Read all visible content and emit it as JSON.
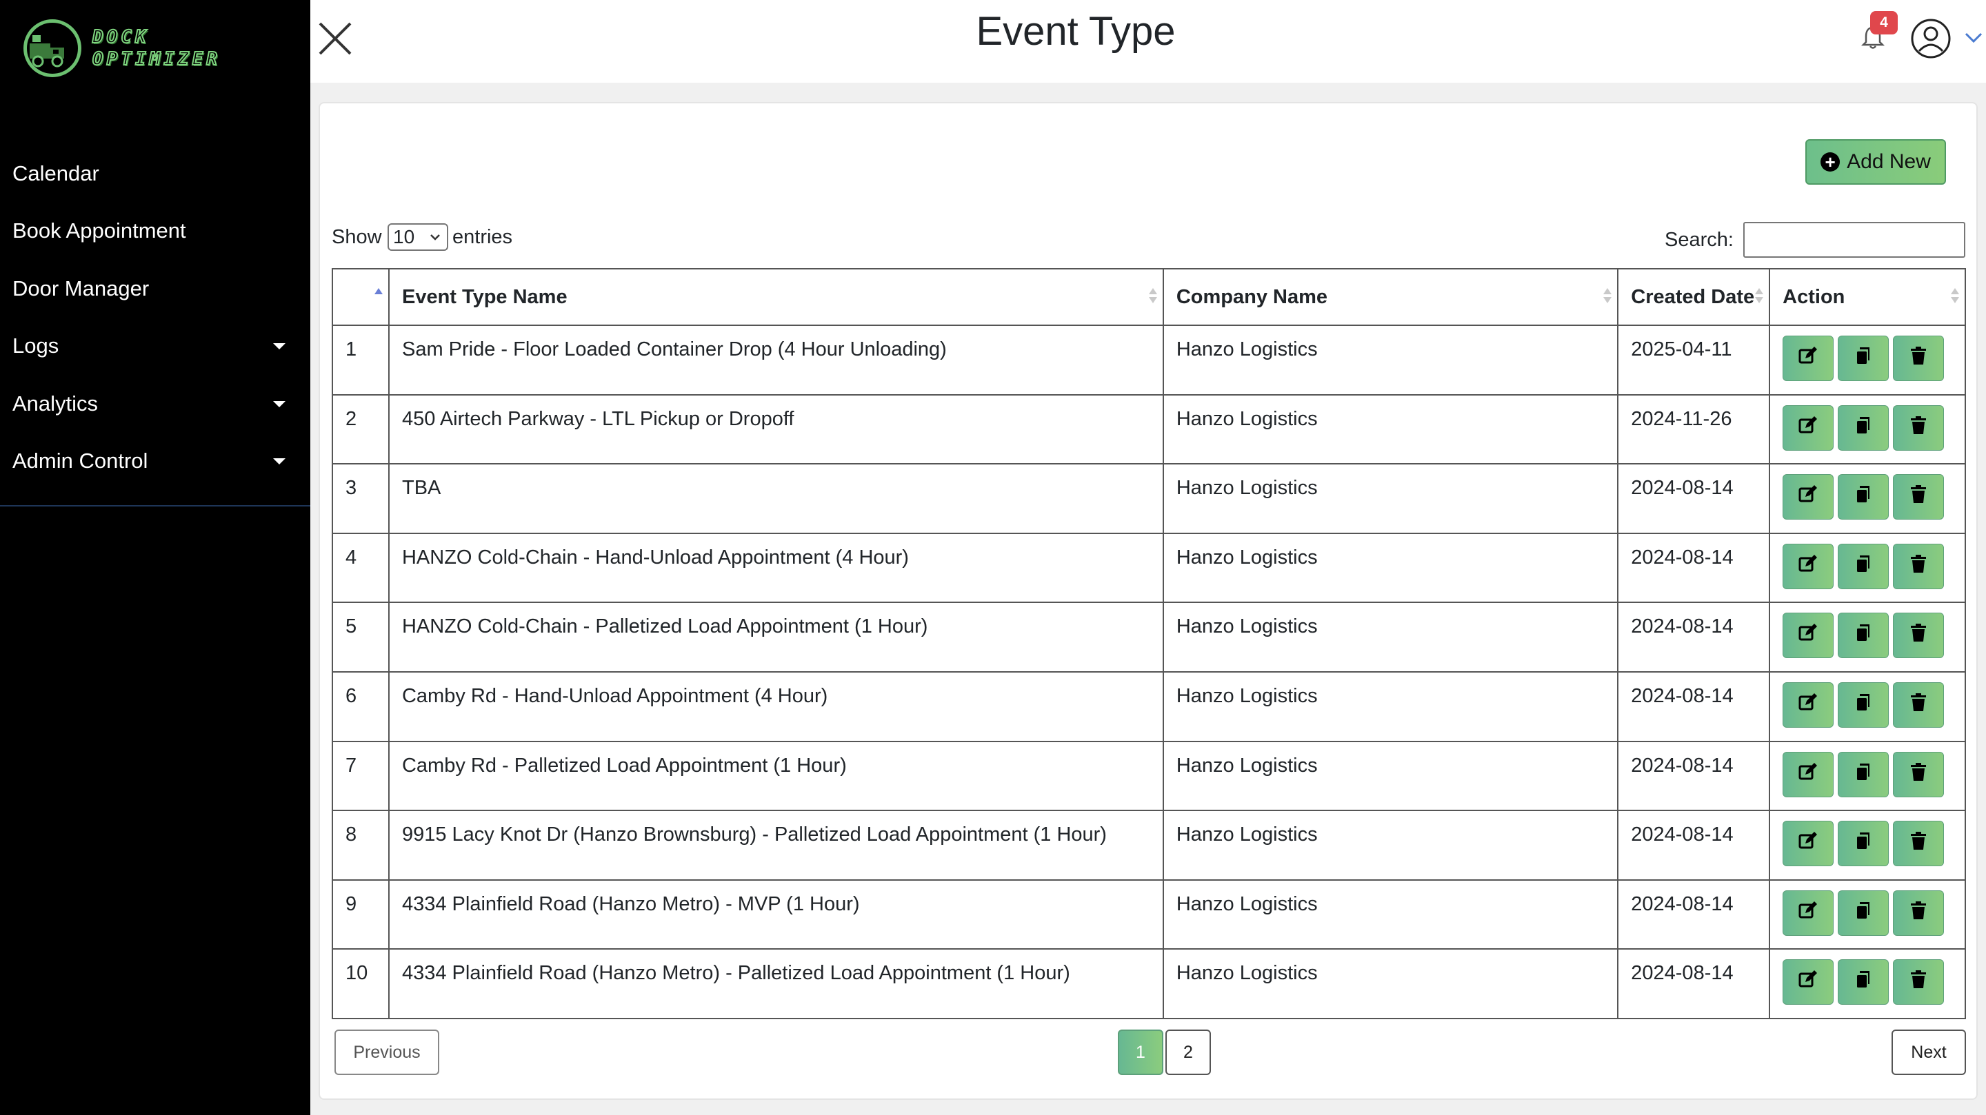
{
  "brand": {
    "line1": "DOCK",
    "line2": "OPTIMIZER"
  },
  "sidebar": {
    "items": [
      {
        "label": "Calendar",
        "has_caret": false
      },
      {
        "label": "Book Appointment",
        "has_caret": false
      },
      {
        "label": "Door Manager",
        "has_caret": false
      },
      {
        "label": "Logs",
        "has_caret": true
      },
      {
        "label": "Analytics",
        "has_caret": true
      },
      {
        "label": "Admin Control",
        "has_caret": true
      }
    ]
  },
  "header": {
    "title": "Event Type",
    "notification_count": "4"
  },
  "toolbar": {
    "add_label": "Add New"
  },
  "table_controls": {
    "show_label": "Show",
    "page_size": "10",
    "entries_label": "entries",
    "search_label": "Search:",
    "search_value": ""
  },
  "table": {
    "columns": [
      "",
      "Event Type Name",
      "Company Name",
      "Created Date",
      "Action"
    ],
    "rows": [
      {
        "num": "1",
        "name": "Sam Pride - Floor Loaded Container Drop (4 Hour Unloading)",
        "company": "Hanzo Logistics",
        "date": "2025-04-11"
      },
      {
        "num": "2",
        "name": "450 Airtech Parkway - LTL Pickup or Dropoff",
        "company": "Hanzo Logistics",
        "date": "2024-11-26"
      },
      {
        "num": "3",
        "name": "TBA",
        "company": "Hanzo Logistics",
        "date": "2024-08-14"
      },
      {
        "num": "4",
        "name": "HANZO Cold-Chain - Hand-Unload Appointment (4 Hour)",
        "company": "Hanzo Logistics",
        "date": "2024-08-14"
      },
      {
        "num": "5",
        "name": "HANZO Cold-Chain - Palletized Load Appointment (1 Hour)",
        "company": "Hanzo Logistics",
        "date": "2024-08-14"
      },
      {
        "num": "6",
        "name": "Camby Rd - Hand-Unload Appointment (4 Hour)",
        "company": "Hanzo Logistics",
        "date": "2024-08-14"
      },
      {
        "num": "7",
        "name": "Camby Rd - Palletized Load Appointment (1 Hour)",
        "company": "Hanzo Logistics",
        "date": "2024-08-14"
      },
      {
        "num": "8",
        "name": "9915 Lacy Knot Dr (Hanzo Brownsburg) - Palletized Load Appointment (1 Hour)",
        "company": "Hanzo Logistics",
        "date": "2024-08-14"
      },
      {
        "num": "9",
        "name": "4334 Plainfield Road (Hanzo Metro) - MVP (1 Hour)",
        "company": "Hanzo Logistics",
        "date": "2024-08-14"
      },
      {
        "num": "10",
        "name": "4334 Plainfield Road (Hanzo Metro) - Palletized Load Appointment (1 Hour)",
        "company": "Hanzo Logistics",
        "date": "2024-08-14"
      }
    ]
  },
  "pagination": {
    "previous": "Previous",
    "pages": [
      "1",
      "2"
    ],
    "current": "1",
    "next": "Next"
  },
  "colors": {
    "sidebar_bg": "#000000",
    "accent_green": "#6dbf8b",
    "badge_red": "#e0474c",
    "sort_active": "#6a7fd6"
  },
  "icons": {
    "close": "close-icon",
    "bell": "bell-icon",
    "user": "user-circle-icon",
    "edit": "edit-icon",
    "copy": "copy-icon",
    "delete": "trash-icon",
    "add": "plus-circle-icon"
  }
}
